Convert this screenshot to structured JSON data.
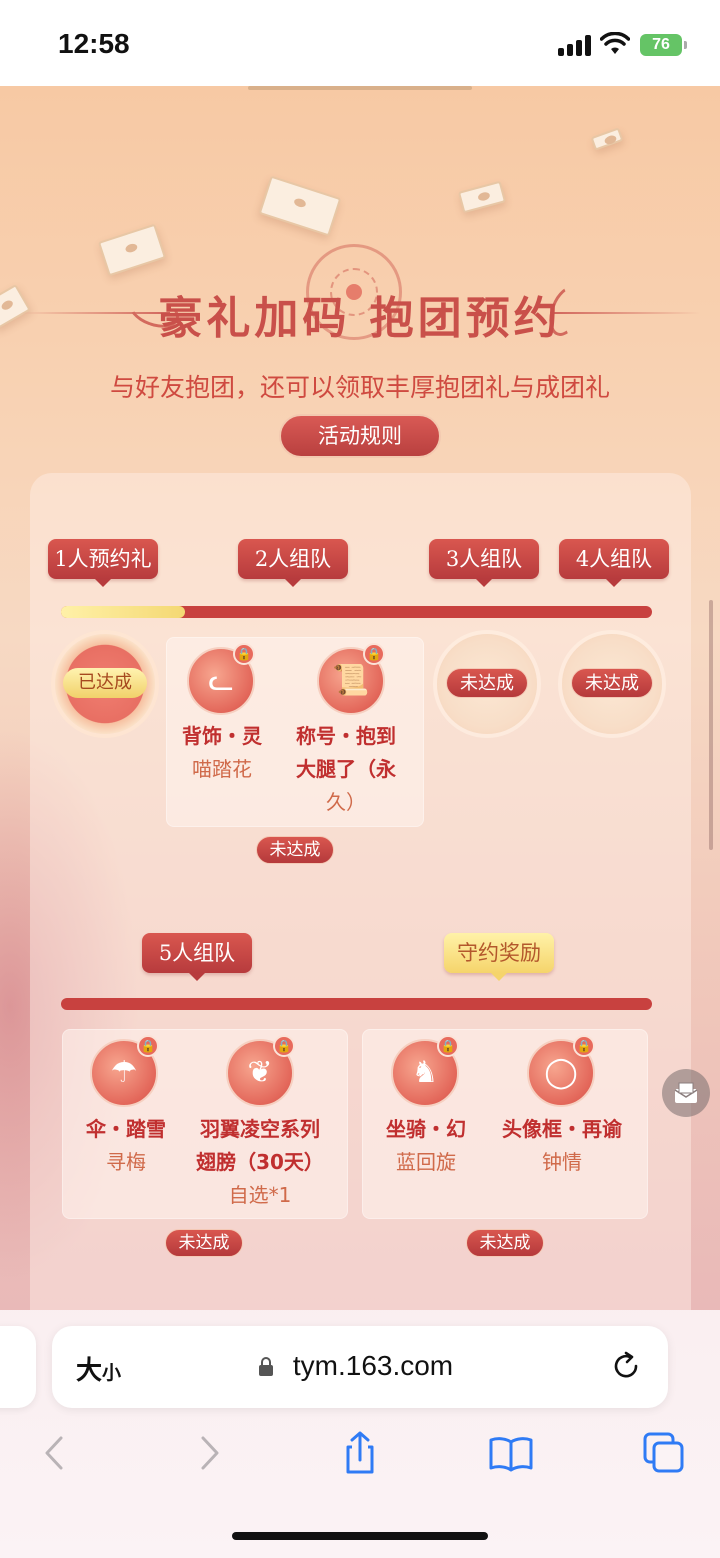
{
  "status_bar": {
    "time": "12:58",
    "battery": "76"
  },
  "header": {
    "title": "豪礼加码 抱团预约",
    "subtitle": "与好友抱团，还可以领取丰厚抱团礼与成团礼",
    "rules_button": "活动规则"
  },
  "tiers_row1": {
    "tags": [
      "1人预约礼",
      "2人组队",
      "3人组队",
      "4人组队"
    ],
    "progress_fraction": 0.21,
    "medal1_status": "已达成",
    "medal3_status": "未达成",
    "medal4_status": "未达成",
    "group2": {
      "item1": {
        "line1": "背饰・灵",
        "line2": "喵踏花",
        "icon": "cat-icon"
      },
      "item2": {
        "line1": "称号・抱到",
        "line2": "大腿了（永",
        "line3": "久）",
        "icon": "scroll-icon"
      },
      "status": "未达成"
    }
  },
  "tiers_row2": {
    "tags": [
      "5人组队",
      "守约奖励"
    ],
    "progress_fraction": 0,
    "group5": {
      "item1": {
        "line1": "伞・踏雪",
        "line2": "寻梅",
        "icon": "umbrella-icon"
      },
      "item2": {
        "line1": "羽翼凌空系列",
        "line2": "翅膀（30天）",
        "line3": "自选*1",
        "icon": "wings-icon"
      },
      "status": "未达成"
    },
    "promise": {
      "item1": {
        "line1": "坐骑・幻",
        "line2": "蓝回旋",
        "icon": "carousel-horse-icon"
      },
      "item2": {
        "line1": "头像框・再谕",
        "line2": "钟情",
        "icon": "ring-frame-icon"
      },
      "status": "未达成"
    }
  },
  "browser": {
    "text_size": "大",
    "text_size_small": "小",
    "url": "tym.163.com"
  },
  "colors": {
    "accent": "#c8413f",
    "gold": "#f5d46b",
    "page_bg": "#f8d2b3"
  }
}
